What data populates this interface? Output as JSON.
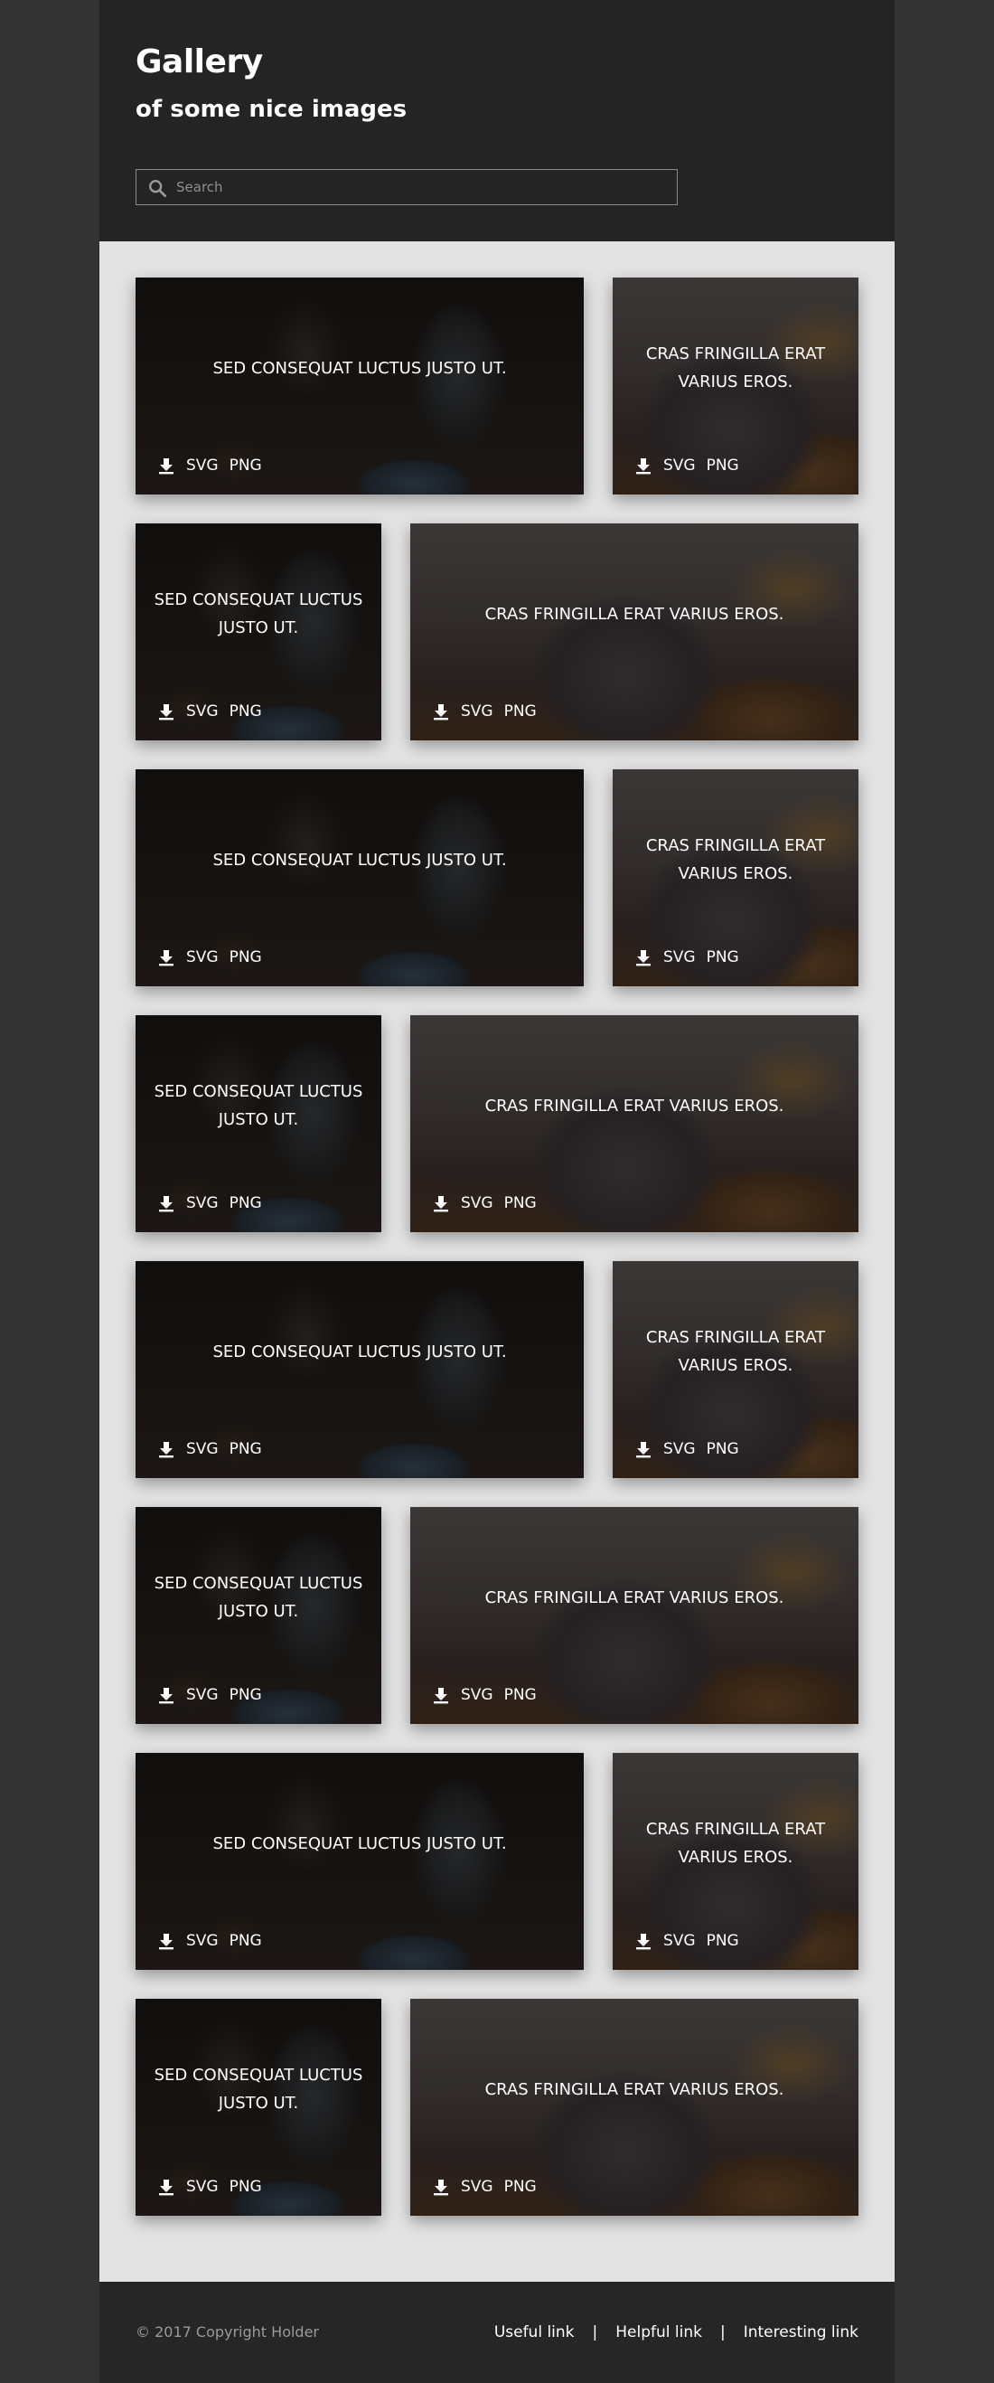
{
  "header": {
    "title": "Gallery",
    "subtitle": "of some nice images",
    "search_placeholder": "Search"
  },
  "gallery": {
    "cards": [
      {
        "caption": "SED CONSEQUAT LUCTUS JUSTO UT.",
        "image": "machine",
        "size": "wide"
      },
      {
        "caption": "CRAS FRINGILLA ERAT VARIUS EROS.",
        "image": "laptop",
        "size": "narrow"
      },
      {
        "caption": "SED CONSEQUAT LUCTUS JUSTO UT.",
        "image": "machine",
        "size": "narrow"
      },
      {
        "caption": "CRAS FRINGILLA ERAT VARIUS EROS.",
        "image": "laptop",
        "size": "wide"
      },
      {
        "caption": "SED CONSEQUAT LUCTUS JUSTO UT.",
        "image": "machine",
        "size": "wide"
      },
      {
        "caption": "CRAS FRINGILLA ERAT VARIUS EROS.",
        "image": "laptop",
        "size": "narrow"
      },
      {
        "caption": "SED CONSEQUAT LUCTUS JUSTO UT.",
        "image": "machine",
        "size": "narrow"
      },
      {
        "caption": "CRAS FRINGILLA ERAT VARIUS EROS.",
        "image": "laptop",
        "size": "wide"
      },
      {
        "caption": "SED CONSEQUAT LUCTUS JUSTO UT.",
        "image": "machine",
        "size": "wide"
      },
      {
        "caption": "CRAS FRINGILLA ERAT VARIUS EROS.",
        "image": "laptop",
        "size": "narrow"
      },
      {
        "caption": "SED CONSEQUAT LUCTUS JUSTO UT.",
        "image": "machine",
        "size": "narrow"
      },
      {
        "caption": "CRAS FRINGILLA ERAT VARIUS EROS.",
        "image": "laptop",
        "size": "wide"
      },
      {
        "caption": "SED CONSEQUAT LUCTUS JUSTO UT.",
        "image": "machine",
        "size": "wide"
      },
      {
        "caption": "CRAS FRINGILLA ERAT VARIUS EROS.",
        "image": "laptop",
        "size": "narrow"
      },
      {
        "caption": "SED CONSEQUAT LUCTUS JUSTO UT.",
        "image": "machine",
        "size": "narrow"
      },
      {
        "caption": "CRAS FRINGILLA ERAT VARIUS EROS.",
        "image": "laptop",
        "size": "wide"
      }
    ],
    "download_formats": [
      "SVG",
      "PNG"
    ],
    "download_icon": "download-icon"
  },
  "footer": {
    "copyright": "© 2017 Copyright Holder",
    "links": [
      "Useful link",
      "Helpful link",
      "Interesting link"
    ],
    "separator": "|"
  },
  "colors": {
    "page_bg": "#333333",
    "header_bg": "#242424",
    "content_bg": "#e3e3e3",
    "footer_bg": "#262626",
    "text": "#ffffff",
    "muted_text": "#9a9a9a"
  }
}
